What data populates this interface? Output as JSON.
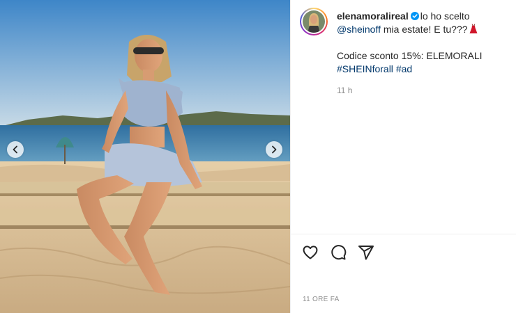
{
  "post": {
    "username": "elenamoralireal",
    "caption_text": "lo ho scelto",
    "caption_mention": "@sheinoff",
    "caption_cont": "mia estate! E tu???",
    "discount_line": "Codice sconto 15%: ELEMORALI",
    "hashtag_1": "#SHEINforall",
    "hashtag_2": "#ad",
    "relative_time": "11 h",
    "timestamp": "11 ORE FA"
  },
  "icons": {
    "verified": "verified-badge-icon",
    "caption_emoji": "red-dress-icon",
    "prev": "chevron-left-icon",
    "next": "chevron-right-icon",
    "like": "heart-icon",
    "comment": "comment-icon",
    "share": "paper-plane-icon"
  },
  "colors": {
    "link": "#00376b",
    "muted": "#8e8e8e",
    "verified": "#0095f6"
  }
}
